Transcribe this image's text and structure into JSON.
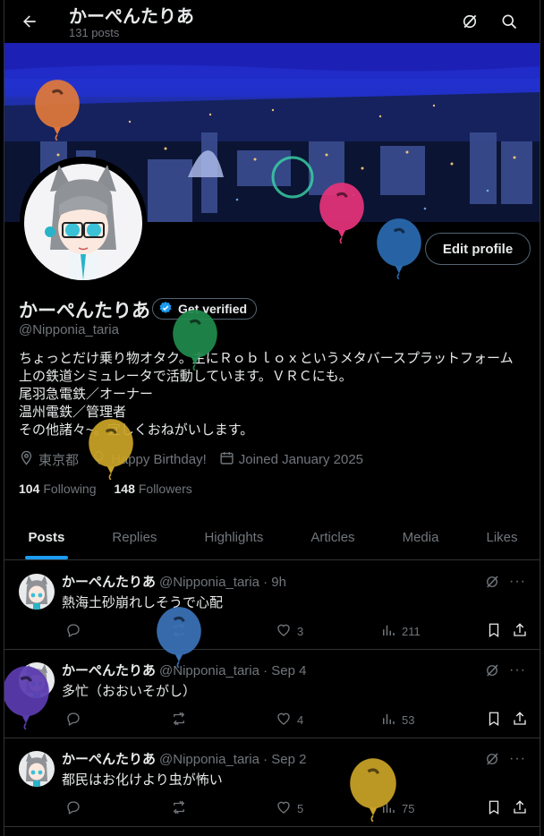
{
  "header": {
    "title": "かーぺんたりあ",
    "post_count": "131 posts"
  },
  "profile": {
    "name": "かーぺんたりあ",
    "verify_label": "Get verified",
    "handle": "@Nipponia_taria",
    "edit_label": "Edit profile",
    "bio_lines": [
      "ちょっとだけ乗り物オタク。主にＲｏｂｌｏｘというメタバースプラットフォーム",
      "上の鉄道シミュレータで活動しています。ＶＲＣにも。",
      "尾羽急電鉄／オーナー",
      "温州電鉄／管理者",
      "その他諸々~。宜しくおねがいします。"
    ],
    "location": "東京都",
    "birthday": "Happy Birthday!",
    "joined": "Joined January 2025",
    "following_count": "104",
    "following_label": "Following",
    "followers_count": "148",
    "followers_label": "Followers"
  },
  "tabs": [
    "Posts",
    "Replies",
    "Highlights",
    "Articles",
    "Media",
    "Likes"
  ],
  "active_tab": "Posts",
  "posts": [
    {
      "name": "かーぺんたりあ",
      "meta": "@Nipponia_taria · 9h",
      "text": "熱海土砂崩れしそうで心配",
      "likes": "3",
      "views": "211"
    },
    {
      "name": "かーぺんたりあ",
      "meta": "@Nipponia_taria · Sep 4",
      "text": "多忙（おおいそがし）",
      "likes": "4",
      "views": "53"
    },
    {
      "name": "かーぺんたりあ",
      "meta": "@Nipponia_taria · Sep 2",
      "text": "都民はお化けより虫が怖い",
      "likes": "5",
      "views": "75"
    }
  ],
  "colors": {
    "accent": "#1d9bf0",
    "background": "#000000",
    "muted": "#71767b",
    "border": "#2f3336"
  },
  "balloon_colors": [
    "#e0783a",
    "#e5337a",
    "#2a6ab0",
    "#1f8a4c",
    "#c9a227",
    "#3a72b8",
    "#5b3bb0",
    "#c9a227"
  ]
}
